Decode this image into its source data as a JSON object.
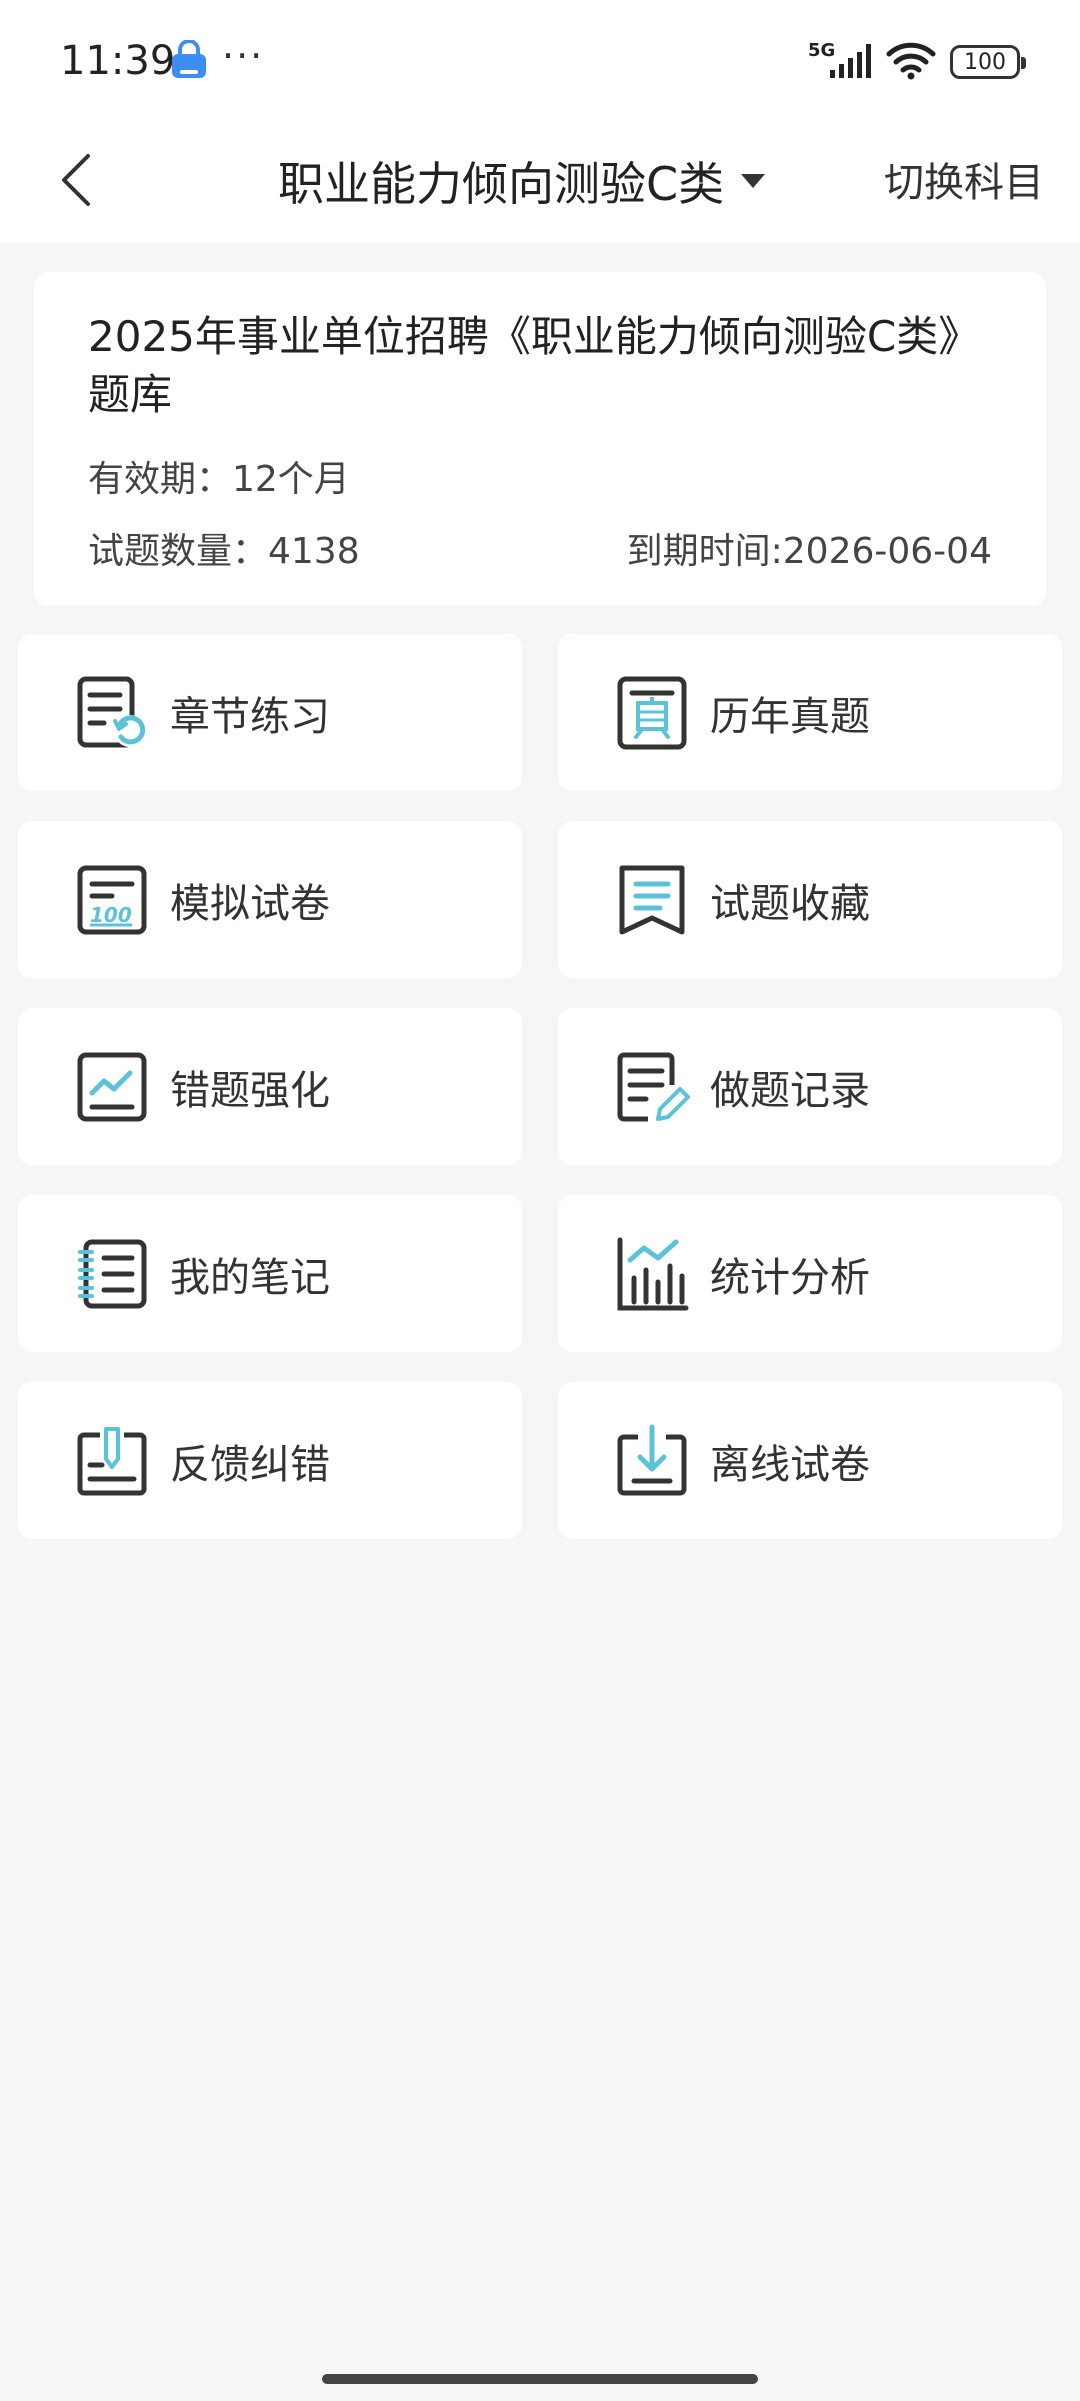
{
  "status_bar": {
    "time": "11:39",
    "more": "···",
    "network": "5G",
    "battery": "100"
  },
  "nav": {
    "title": "职业能力倾向测验C类",
    "switch_label": "切换科目"
  },
  "info": {
    "title": "2025年事业单位招聘《职业能力倾向测验C类》题库",
    "validity": "有效期：12个月",
    "count": "试题数量：4138",
    "expiry": "到期时间:2026-06-04"
  },
  "menu": [
    {
      "label": "章节练习",
      "icon": "chapter-practice-icon"
    },
    {
      "label": "历年真题",
      "icon": "past-exam-icon"
    },
    {
      "label": "模拟试卷",
      "icon": "mock-paper-icon"
    },
    {
      "label": "试题收藏",
      "icon": "favorites-icon"
    },
    {
      "label": "错题强化",
      "icon": "wrong-questions-icon"
    },
    {
      "label": "做题记录",
      "icon": "practice-record-icon"
    },
    {
      "label": "我的笔记",
      "icon": "notes-icon"
    },
    {
      "label": "统计分析",
      "icon": "statistics-icon"
    },
    {
      "label": "反馈纠错",
      "icon": "feedback-icon"
    },
    {
      "label": "离线试卷",
      "icon": "offline-paper-icon"
    }
  ],
  "colors": {
    "accent": "#5bc3d9",
    "icon_stroke": "#333333",
    "background": "#f6f6f7",
    "card": "#ffffff"
  }
}
